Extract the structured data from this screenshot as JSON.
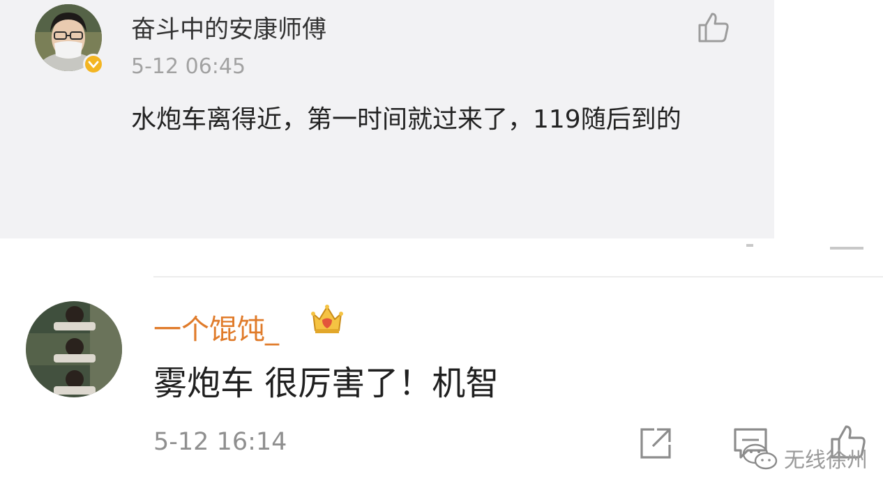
{
  "comments": [
    {
      "author": "奋斗中的安康师傅",
      "timestamp": "5-12 06:45",
      "text": "水炮车离得近，第一时间就过来了，119随后到的",
      "verified": true
    },
    {
      "author": "一个馄饨_",
      "timestamp": "5-12 16:14",
      "text": "雾炮车 很厉害了！机智",
      "badge": "crown-icon"
    }
  ],
  "watermark": {
    "text": "无线徐州"
  },
  "colors": {
    "card_background": "#f2f2f4",
    "author_highlight": "#e07b2a",
    "verified_badge": "#f3b522",
    "meta_text": "#a2a2a2"
  }
}
